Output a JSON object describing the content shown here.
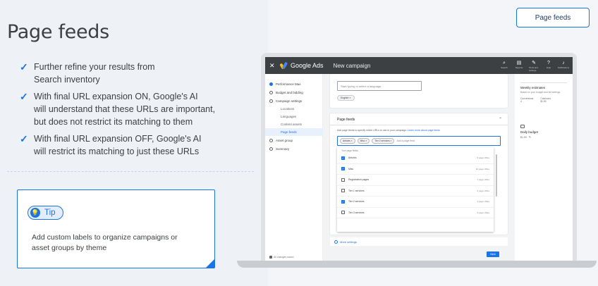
{
  "slide": {
    "title": "Page feeds",
    "bullets": [
      {
        "lines": [
          "Further refine your results from",
          "Search inventory"
        ]
      },
      {
        "lines": [
          "With final URL expansion ON, Google's AI",
          "will understand that these URLs are important,",
          "but does not restrict its matching to them"
        ]
      },
      {
        "lines": [
          "With final URL expansion OFF, Google's AI",
          "will restrict its matching to just these URLs"
        ]
      }
    ],
    "tip": {
      "label": "Tip",
      "text_lines": [
        "Add custom labels to organize campaigns or",
        "asset groups by theme"
      ]
    },
    "corner_button": "Page feeds"
  },
  "app": {
    "name": "Google Ads",
    "campaign_title": "New campaign",
    "tools": [
      "Search",
      "Reports",
      "Tools and settings",
      "Help",
      "Notifications"
    ],
    "sidebar": {
      "items": [
        {
          "label": "Performance Max",
          "done": true
        },
        {
          "label": "Budget and bidding",
          "done": false
        },
        {
          "label": "Campaign settings",
          "done": false
        }
      ],
      "subitems": [
        "Locations",
        "Languages",
        "Content assets",
        "Page feeds"
      ],
      "active_subitem": "Page feeds",
      "items2": [
        "Asset group",
        "Summary"
      ],
      "footer": "All changes saved"
    },
    "languages": {
      "placeholder": "Start typing or select a language",
      "chip": "English ×"
    },
    "page_feeds": {
      "heading": "Page feeds",
      "description": "Add page feeds to specify which URLs to use in your campaign.",
      "link": "Learn more about page feeds",
      "chips": [
        "Articles ×",
        "Misc ×",
        "Tier 2 services ×"
      ],
      "placeholder": "Add a page feed",
      "dropdown_header": "Your page feeds",
      "rows": [
        {
          "name": "Articles",
          "count": "5 page URLs",
          "checked": true
        },
        {
          "name": "Misc",
          "count": "10 page URLs",
          "checked": true
        },
        {
          "name": "Registration pages",
          "count": "7 page URLs",
          "checked": false
        },
        {
          "name": "Tier 1 services",
          "count": "6 page URLs",
          "checked": false
        },
        {
          "name": "Tier 2 services",
          "count": "4 page URLs",
          "checked": true
        },
        {
          "name": "Tier 3 services",
          "count": "5 page URLs",
          "checked": false
        }
      ]
    },
    "more_settings": "More settings",
    "next": "Next",
    "right_panel": {
      "title": "Weekly estimates",
      "subtitle": "Based on your budget and bid settings",
      "stats": [
        {
          "label": "Conversions",
          "value": "4"
        },
        {
          "label": "Cost/conv.",
          "value": "$1.90"
        }
      ],
      "budget_title": "Daily budget",
      "budget_value": "$1.00"
    }
  }
}
